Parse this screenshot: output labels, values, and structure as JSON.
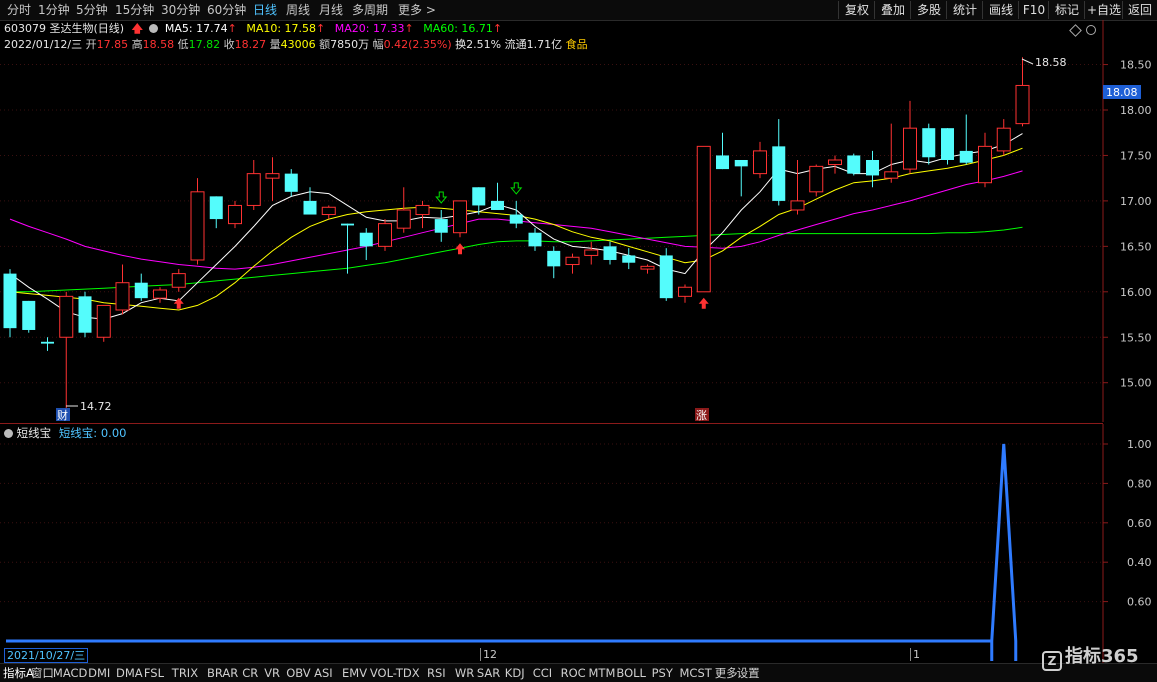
{
  "toolbar": {
    "periods": [
      "分时",
      "1分钟",
      "5分钟",
      "15分钟",
      "30分钟",
      "60分钟",
      "日线",
      "周线",
      "月线",
      "多周期",
      "更多 >"
    ],
    "active_period": "日线",
    "right_buttons": [
      "复权",
      "叠加",
      "多股",
      "统计",
      "画线",
      "F10",
      "标记",
      "+自选",
      "返回"
    ]
  },
  "stock": {
    "title": "603079 圣达生物(日线)",
    "ma5": "MA5: 17.74",
    "ma10": "MA10: 17.58",
    "ma20": "MA20: 17.33",
    "ma60": "MA60: 16.71",
    "date": "2022/01/12/三",
    "open_label": "开",
    "open": "17.85",
    "high_label": "高",
    "high": "18.58",
    "low_label": "低",
    "low": "17.82",
    "close_label": "收",
    "close": "18.27",
    "vol_label": "量",
    "vol": "43006",
    "amt_label": "额",
    "amt": "7850万",
    "chg_label": "幅",
    "chg": "0.42(2.35%)",
    "turnover": "换2.51%",
    "float": "流通1.71亿",
    "sector": "食品"
  },
  "price_axis": {
    "ticks": [
      "18.50",
      "18.00",
      "17.50",
      "17.00",
      "16.50",
      "16.00",
      "15.50",
      "15.00"
    ],
    "current": "18.08",
    "max_label": "18.58",
    "min_label": "14.72"
  },
  "markers": {
    "cai": "财",
    "zhang": "涨"
  },
  "sub": {
    "title": "短线宝",
    "value_label": "短线宝: 0.00",
    "ticks": [
      "1.00",
      "0.80",
      "0.60",
      "0.40",
      "0.60"
    ]
  },
  "time_axis": {
    "start_date": "2021/10/27/三",
    "label_12": "12",
    "label_1": "1"
  },
  "indicators": [
    "指标A",
    "窗口",
    "MACD",
    "DMI",
    "DMA",
    "FSL",
    "TRIX",
    "BRAR",
    "CR",
    "VR",
    "OBV",
    "ASI",
    "EMV",
    "VOL-TDX",
    "RSI",
    "WR",
    "SAR",
    "KDJ",
    "CCI",
    "ROC",
    "MTM",
    "BOLL",
    "PSY",
    "MCST",
    "更多",
    "设置"
  ],
  "watermark": "指标365",
  "colors": {
    "up": "#ff3232",
    "down": "#54fcfc",
    "ma5": "#ffffff",
    "ma10": "#ffff00",
    "ma20": "#ff00ff",
    "ma60": "#00ff00",
    "accent": "#4fc3ff",
    "subline": "#2f7bff"
  },
  "chart_data": {
    "type": "candlestick",
    "ylim": [
      14.6,
      18.8
    ],
    "candles": [
      {
        "o": 16.2,
        "h": 16.25,
        "l": 15.5,
        "c": 15.6
      },
      {
        "o": 15.9,
        "h": 15.9,
        "l": 15.55,
        "c": 15.58
      },
      {
        "o": 15.45,
        "h": 15.5,
        "l": 15.35,
        "c": 15.43
      },
      {
        "o": 15.5,
        "h": 16.0,
        "l": 14.72,
        "c": 15.95
      },
      {
        "o": 15.95,
        "h": 16.0,
        "l": 15.5,
        "c": 15.55
      },
      {
        "o": 15.5,
        "h": 15.85,
        "l": 15.45,
        "c": 15.85
      },
      {
        "o": 15.8,
        "h": 16.3,
        "l": 15.75,
        "c": 16.1
      },
      {
        "o": 16.1,
        "h": 16.2,
        "l": 15.9,
        "c": 15.93
      },
      {
        "o": 15.93,
        "h": 16.05,
        "l": 15.88,
        "c": 16.02
      },
      {
        "o": 16.05,
        "h": 16.25,
        "l": 16.0,
        "c": 16.2
      },
      {
        "o": 16.35,
        "h": 17.25,
        "l": 16.3,
        "c": 17.1
      },
      {
        "o": 17.05,
        "h": 17.05,
        "l": 16.7,
        "c": 16.8
      },
      {
        "o": 16.75,
        "h": 17.0,
        "l": 16.7,
        "c": 16.95
      },
      {
        "o": 16.95,
        "h": 17.45,
        "l": 16.9,
        "c": 17.3
      },
      {
        "o": 17.25,
        "h": 17.48,
        "l": 17.0,
        "c": 17.3
      },
      {
        "o": 17.3,
        "h": 17.35,
        "l": 17.05,
        "c": 17.1
      },
      {
        "o": 17.0,
        "h": 17.15,
        "l": 16.85,
        "c": 16.85
      },
      {
        "o": 16.85,
        "h": 16.95,
        "l": 16.8,
        "c": 16.93
      },
      {
        "o": 16.75,
        "h": 16.75,
        "l": 16.2,
        "c": 16.73
      },
      {
        "o": 16.65,
        "h": 16.7,
        "l": 16.35,
        "c": 16.5
      },
      {
        "o": 16.5,
        "h": 16.8,
        "l": 16.45,
        "c": 16.75
      },
      {
        "o": 16.7,
        "h": 17.15,
        "l": 16.65,
        "c": 16.9
      },
      {
        "o": 16.85,
        "h": 17.0,
        "l": 16.7,
        "c": 16.95
      },
      {
        "o": 16.8,
        "h": 16.9,
        "l": 16.55,
        "c": 16.65
      },
      {
        "o": 16.65,
        "h": 17.0,
        "l": 16.6,
        "c": 17.0
      },
      {
        "o": 17.15,
        "h": 17.15,
        "l": 16.85,
        "c": 16.95
      },
      {
        "o": 17.0,
        "h": 17.2,
        "l": 16.9,
        "c": 16.9
      },
      {
        "o": 16.85,
        "h": 17.0,
        "l": 16.7,
        "c": 16.75
      },
      {
        "o": 16.65,
        "h": 16.7,
        "l": 16.45,
        "c": 16.5
      },
      {
        "o": 16.45,
        "h": 16.5,
        "l": 16.15,
        "c": 16.28
      },
      {
        "o": 16.3,
        "h": 16.42,
        "l": 16.2,
        "c": 16.38
      },
      {
        "o": 16.4,
        "h": 16.55,
        "l": 16.3,
        "c": 16.46
      },
      {
        "o": 16.5,
        "h": 16.55,
        "l": 16.3,
        "c": 16.35
      },
      {
        "o": 16.4,
        "h": 16.48,
        "l": 16.25,
        "c": 16.32
      },
      {
        "o": 16.25,
        "h": 16.3,
        "l": 16.2,
        "c": 16.28
      },
      {
        "o": 16.4,
        "h": 16.48,
        "l": 15.9,
        "c": 15.93
      },
      {
        "o": 15.95,
        "h": 16.08,
        "l": 15.88,
        "c": 16.05
      },
      {
        "o": 16.0,
        "h": 17.6,
        "l": 16.0,
        "c": 17.6
      },
      {
        "o": 17.5,
        "h": 17.75,
        "l": 17.35,
        "c": 17.35
      },
      {
        "o": 17.45,
        "h": 17.45,
        "l": 17.05,
        "c": 17.38
      },
      {
        "o": 17.3,
        "h": 17.65,
        "l": 17.25,
        "c": 17.55
      },
      {
        "o": 17.6,
        "h": 17.9,
        "l": 16.95,
        "c": 17.0
      },
      {
        "o": 16.9,
        "h": 17.45,
        "l": 16.85,
        "c": 17.0
      },
      {
        "o": 17.1,
        "h": 17.4,
        "l": 17.05,
        "c": 17.38
      },
      {
        "o": 17.4,
        "h": 17.5,
        "l": 17.3,
        "c": 17.45
      },
      {
        "o": 17.5,
        "h": 17.52,
        "l": 17.28,
        "c": 17.3
      },
      {
        "o": 17.45,
        "h": 17.55,
        "l": 17.15,
        "c": 17.28
      },
      {
        "o": 17.25,
        "h": 17.85,
        "l": 17.2,
        "c": 17.32
      },
      {
        "o": 17.35,
        "h": 18.1,
        "l": 17.3,
        "c": 17.8
      },
      {
        "o": 17.8,
        "h": 17.85,
        "l": 17.4,
        "c": 17.48
      },
      {
        "o": 17.8,
        "h": 17.8,
        "l": 17.4,
        "c": 17.45
      },
      {
        "o": 17.55,
        "h": 17.95,
        "l": 17.4,
        "c": 17.42
      },
      {
        "o": 17.2,
        "h": 17.75,
        "l": 17.15,
        "c": 17.6
      },
      {
        "o": 17.55,
        "h": 17.9,
        "l": 17.5,
        "c": 17.8
      },
      {
        "o": 17.85,
        "h": 18.58,
        "l": 17.82,
        "c": 18.27
      }
    ],
    "ma5": [
      16.2,
      16.05,
      15.92,
      15.78,
      15.72,
      15.7,
      15.76,
      15.88,
      15.93,
      15.9,
      16.1,
      16.3,
      16.5,
      16.72,
      16.95,
      17.05,
      17.1,
      17.08,
      16.95,
      16.82,
      16.78,
      16.78,
      16.82,
      16.81,
      16.84,
      16.88,
      16.96,
      16.9,
      16.72,
      16.58,
      16.5,
      16.48,
      16.45,
      16.4,
      16.35,
      16.25,
      16.2,
      16.45,
      16.65,
      16.9,
      17.1,
      17.35,
      17.3,
      17.35,
      17.38,
      17.3,
      17.3,
      17.4,
      17.45,
      17.42,
      17.48,
      17.52,
      17.55,
      17.62,
      17.74
    ],
    "ma10": [
      16.0,
      15.98,
      15.96,
      15.94,
      15.92,
      15.88,
      15.86,
      15.84,
      15.82,
      15.8,
      15.85,
      15.95,
      16.1,
      16.28,
      16.45,
      16.6,
      16.72,
      16.8,
      16.85,
      16.88,
      16.9,
      16.92,
      16.93,
      16.92,
      16.9,
      16.88,
      16.86,
      16.84,
      16.8,
      16.74,
      16.66,
      16.6,
      16.56,
      16.5,
      16.44,
      16.38,
      16.32,
      16.35,
      16.45,
      16.6,
      16.72,
      16.85,
      16.92,
      17.02,
      17.12,
      17.2,
      17.22,
      17.25,
      17.3,
      17.33,
      17.36,
      17.4,
      17.45,
      17.5,
      17.58
    ],
    "ma20": [
      16.8,
      16.72,
      16.65,
      16.58,
      16.5,
      16.45,
      16.4,
      16.36,
      16.33,
      16.3,
      16.28,
      16.26,
      16.25,
      16.27,
      16.3,
      16.34,
      16.38,
      16.42,
      16.46,
      16.5,
      16.55,
      16.6,
      16.65,
      16.7,
      16.75,
      16.8,
      16.8,
      16.78,
      16.76,
      16.74,
      16.72,
      16.7,
      16.66,
      16.62,
      16.58,
      16.54,
      16.5,
      16.49,
      16.48,
      16.5,
      16.55,
      16.62,
      16.68,
      16.74,
      16.8,
      16.86,
      16.9,
      16.95,
      17.0,
      17.06,
      17.12,
      17.18,
      17.22,
      17.27,
      17.33
    ],
    "ma60": [
      16.0,
      16.0,
      16.01,
      16.02,
      16.03,
      16.04,
      16.05,
      16.06,
      16.07,
      16.08,
      16.1,
      16.12,
      16.14,
      16.16,
      16.18,
      16.2,
      16.22,
      16.24,
      16.26,
      16.29,
      16.32,
      16.36,
      16.4,
      16.44,
      16.48,
      16.52,
      16.55,
      16.56,
      16.56,
      16.55,
      16.55,
      16.56,
      16.57,
      16.58,
      16.59,
      16.6,
      16.61,
      16.62,
      16.63,
      16.64,
      16.64,
      16.64,
      16.64,
      16.64,
      16.64,
      16.64,
      16.64,
      16.64,
      16.64,
      16.64,
      16.65,
      16.65,
      16.66,
      16.68,
      16.71
    ],
    "sub_series": {
      "name": "短线宝",
      "ylim": [
        0,
        1
      ],
      "spike_index": 53,
      "peak": 1.0
    }
  }
}
